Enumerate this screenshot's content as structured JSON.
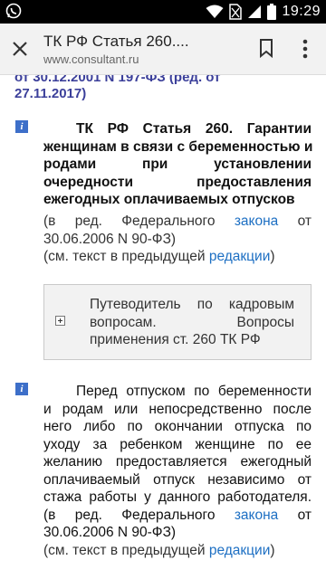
{
  "status_bar": {
    "time": "19:29",
    "icons": [
      "whatsapp-icon",
      "wifi-icon",
      "no-sim-icon",
      "signal-icon",
      "battery-icon"
    ]
  },
  "toolbar": {
    "title": "ТК РФ Статья 260....",
    "url": "www.consultant.ru",
    "icons": [
      "close-icon",
      "bookmark-icon",
      "overflow-menu-icon"
    ]
  },
  "content": {
    "top_partial": [
      "от 30.12.2001 N 197-ФЗ (ред. от",
      "27.11.2017)"
    ],
    "article_title_lines": [
      "ТК РФ Статья 260. Гарантии",
      "женщинам в связи с беременностью и",
      "родами при установлении",
      "очередности предоставления",
      "ежегодных оплачиваемых отпусков"
    ],
    "amendment_note": {
      "line1_prefix": "(в ред. Федерального",
      "line1_link": "закона",
      "line1_suffix": "от",
      "line2": "30.06.2006 N 90-ФЗ)"
    },
    "previous_edition_note": {
      "prefix": "(см. текст в предыдущей ",
      "link": "редакции",
      "suffix": ")"
    },
    "guide_box": {
      "lines": [
        "Путеводитель по кадровым",
        "вопросам. Вопросы",
        "применения ст. 260 ТК РФ"
      ]
    },
    "paragraph_lines": [
      "Перед отпуском по беременности",
      "и родам или непосредственно после",
      "него либо по окончании отпуска по",
      "уходу за ребенком женщине по ее",
      "желанию предоставляется ежегодный",
      "оплачиваемый отпуск независимо от",
      "стажа работы у данного работодателя."
    ],
    "paragraph_amendment": {
      "line1_prefix": "(в ред. Федерального",
      "line1_link": "закона",
      "line1_suffix": "от",
      "line2": "30.06.2006 N 90-ФЗ)"
    },
    "paragraph_previous_edition": {
      "prefix": "(см. текст в предыдущей ",
      "link": "редакции",
      "suffix": ")"
    },
    "colors": {
      "link": "#1d6fc3",
      "heading_link": "#3b3f9a",
      "info_icon": "#3d6fc9"
    }
  }
}
